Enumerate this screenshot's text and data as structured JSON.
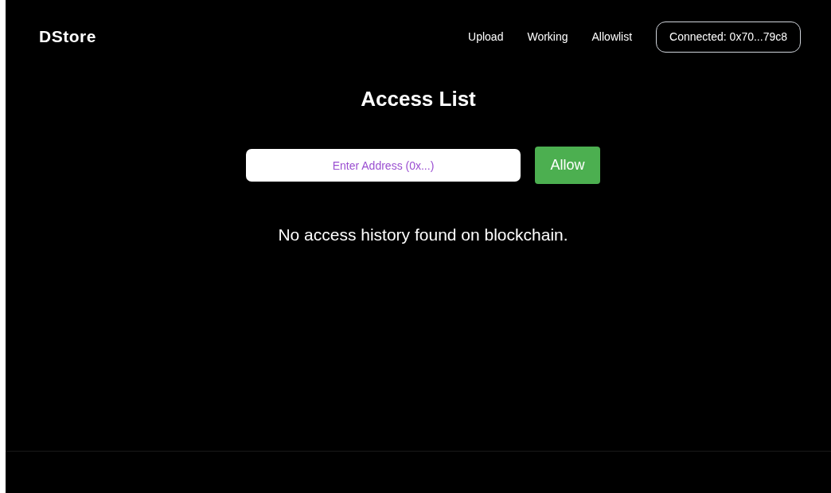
{
  "header": {
    "logo": "DStore",
    "nav": [
      {
        "label": "Upload"
      },
      {
        "label": "Working"
      },
      {
        "label": "Allowlist"
      }
    ],
    "wallet": "Connected: 0x70...79c8"
  },
  "title": "Access List",
  "address_field": {
    "placeholder": "Enter Address (0x...)"
  },
  "allow_button": "Allow",
  "message": "No access history found on blockchain."
}
